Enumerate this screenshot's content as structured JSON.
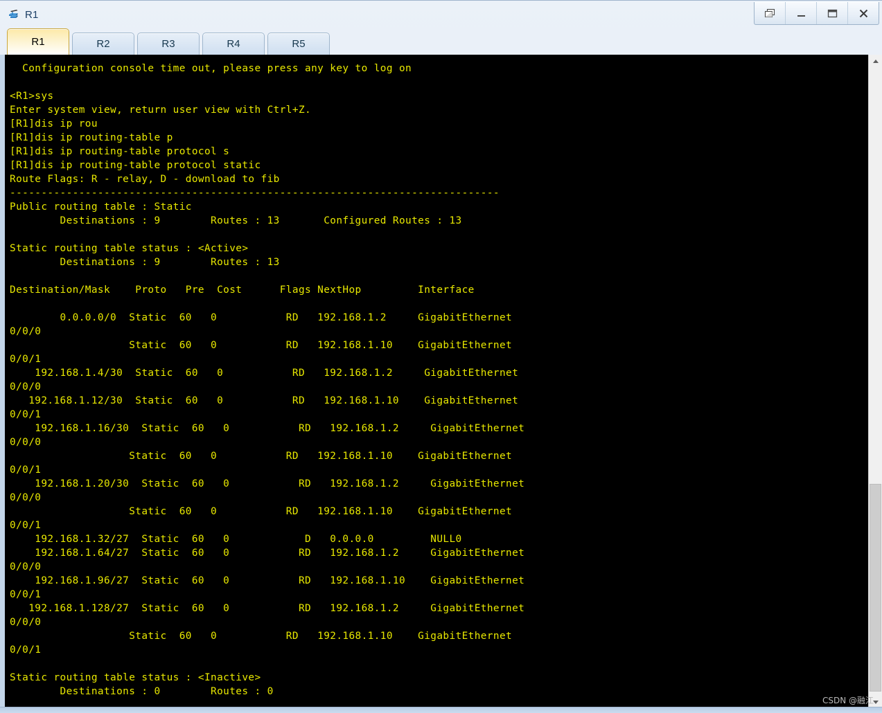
{
  "window": {
    "title": "R1",
    "icon": "router-icon",
    "controls": [
      {
        "name": "restore-button",
        "glyph": "restore-icon"
      },
      {
        "name": "minimize-button",
        "glyph": "minimize-icon"
      },
      {
        "name": "maximize-button",
        "glyph": "maximize-icon"
      },
      {
        "name": "close-button",
        "glyph": "close-icon"
      }
    ]
  },
  "tabs": [
    {
      "label": "R1",
      "active": true
    },
    {
      "label": "R2",
      "active": false
    },
    {
      "label": "R3",
      "active": false
    },
    {
      "label": "R4",
      "active": false
    },
    {
      "label": "R5",
      "active": false
    }
  ],
  "colors": {
    "terminal_background": "#000000",
    "terminal_text": "#e8e800",
    "active_tab_accent": "#fde9a8",
    "titlebar_text": "#1c3f66"
  },
  "scrollbar": {
    "up_arrow": "chevron-up-icon",
    "down_arrow": "chevron-down-icon"
  },
  "watermark": "CSDN @融江",
  "terminal": {
    "lines": [
      "  Configuration console time out, please press any key to log on",
      "",
      "<R1>sys",
      "Enter system view, return user view with Ctrl+Z.",
      "[R1]dis ip rou",
      "[R1]dis ip routing-table p",
      "[R1]dis ip routing-table protocol s",
      "[R1]dis ip routing-table protocol static",
      "Route Flags: R - relay, D - download to fib",
      "------------------------------------------------------------------------------",
      "Public routing table : Static",
      "        Destinations : 9        Routes : 13       Configured Routes : 13",
      "",
      "Static routing table status : <Active>",
      "        Destinations : 9        Routes : 13",
      "",
      "Destination/Mask    Proto   Pre  Cost      Flags NextHop         Interface",
      "",
      "        0.0.0.0/0  Static  60   0           RD   192.168.1.2     GigabitEthernet",
      "0/0/0",
      "                   Static  60   0           RD   192.168.1.10    GigabitEthernet",
      "0/0/1",
      "    192.168.1.4/30  Static  60   0           RD   192.168.1.2     GigabitEthernet",
      "0/0/0",
      "   192.168.1.12/30  Static  60   0           RD   192.168.1.10    GigabitEthernet",
      "0/0/1",
      "    192.168.1.16/30  Static  60   0           RD   192.168.1.2     GigabitEthernet",
      "0/0/0",
      "                   Static  60   0           RD   192.168.1.10    GigabitEthernet",
      "0/0/1",
      "    192.168.1.20/30  Static  60   0           RD   192.168.1.2     GigabitEthernet",
      "0/0/0",
      "                   Static  60   0           RD   192.168.1.10    GigabitEthernet",
      "0/0/1",
      "    192.168.1.32/27  Static  60   0            D   0.0.0.0         NULL0",
      "    192.168.1.64/27  Static  60   0           RD   192.168.1.2     GigabitEthernet",
      "0/0/0",
      "    192.168.1.96/27  Static  60   0           RD   192.168.1.10    GigabitEthernet",
      "0/0/1",
      "   192.168.1.128/27  Static  60   0           RD   192.168.1.2     GigabitEthernet",
      "0/0/0",
      "                   Static  60   0           RD   192.168.1.10    GigabitEthernet",
      "0/0/1",
      "",
      "Static routing table status : <Inactive>",
      "        Destinations : 0        Routes : 0"
    ],
    "session": {
      "prompt_user_view": "<R1>",
      "prompt_system_view": "[R1]",
      "commands": [
        "sys",
        "dis ip rou",
        "dis ip routing-table p",
        "dis ip routing-table protocol s",
        "dis ip routing-table protocol static"
      ],
      "route_flags_legend": "Route Flags: R - relay, D - download to fib",
      "public_routing_table": "Static",
      "public_destinations": "9",
      "public_routes": "13",
      "configured_routes": "13",
      "active_status": "<Active>",
      "active_destinations": "9",
      "active_routes": "13",
      "inactive_status": "<Inactive>",
      "inactive_destinations": "0",
      "inactive_routes": "0",
      "table_headers": [
        "Destination/Mask",
        "Proto",
        "Pre",
        "Cost",
        "Flags",
        "NextHop",
        "Interface"
      ],
      "routes": [
        {
          "destination": "0.0.0.0/0",
          "proto": "Static",
          "pre": "60",
          "cost": "0",
          "flags": "RD",
          "nexthop": "192.168.1.2",
          "interface": "GigabitEthernet0/0/0"
        },
        {
          "destination": "",
          "proto": "Static",
          "pre": "60",
          "cost": "0",
          "flags": "RD",
          "nexthop": "192.168.1.10",
          "interface": "GigabitEthernet0/0/1"
        },
        {
          "destination": "192.168.1.4/30",
          "proto": "Static",
          "pre": "60",
          "cost": "0",
          "flags": "RD",
          "nexthop": "192.168.1.2",
          "interface": "GigabitEthernet0/0/0"
        },
        {
          "destination": "192.168.1.12/30",
          "proto": "Static",
          "pre": "60",
          "cost": "0",
          "flags": "RD",
          "nexthop": "192.168.1.10",
          "interface": "GigabitEthernet0/0/1"
        },
        {
          "destination": "192.168.1.16/30",
          "proto": "Static",
          "pre": "60",
          "cost": "0",
          "flags": "RD",
          "nexthop": "192.168.1.2",
          "interface": "GigabitEthernet0/0/0"
        },
        {
          "destination": "",
          "proto": "Static",
          "pre": "60",
          "cost": "0",
          "flags": "RD",
          "nexthop": "192.168.1.10",
          "interface": "GigabitEthernet0/0/1"
        },
        {
          "destination": "192.168.1.20/30",
          "proto": "Static",
          "pre": "60",
          "cost": "0",
          "flags": "RD",
          "nexthop": "192.168.1.2",
          "interface": "GigabitEthernet0/0/0"
        },
        {
          "destination": "",
          "proto": "Static",
          "pre": "60",
          "cost": "0",
          "flags": "RD",
          "nexthop": "192.168.1.10",
          "interface": "GigabitEthernet0/0/1"
        },
        {
          "destination": "192.168.1.32/27",
          "proto": "Static",
          "pre": "60",
          "cost": "0",
          "flags": "D",
          "nexthop": "0.0.0.0",
          "interface": "NULL0"
        },
        {
          "destination": "192.168.1.64/27",
          "proto": "Static",
          "pre": "60",
          "cost": "0",
          "flags": "RD",
          "nexthop": "192.168.1.2",
          "interface": "GigabitEthernet0/0/0"
        },
        {
          "destination": "192.168.1.96/27",
          "proto": "Static",
          "pre": "60",
          "cost": "0",
          "flags": "RD",
          "nexthop": "192.168.1.10",
          "interface": "GigabitEthernet0/0/1"
        },
        {
          "destination": "192.168.1.128/27",
          "proto": "Static",
          "pre": "60",
          "cost": "0",
          "flags": "RD",
          "nexthop": "192.168.1.2",
          "interface": "GigabitEthernet0/0/0"
        },
        {
          "destination": "",
          "proto": "Static",
          "pre": "60",
          "cost": "0",
          "flags": "RD",
          "nexthop": "192.168.1.10",
          "interface": "GigabitEthernet0/0/1"
        }
      ]
    }
  }
}
